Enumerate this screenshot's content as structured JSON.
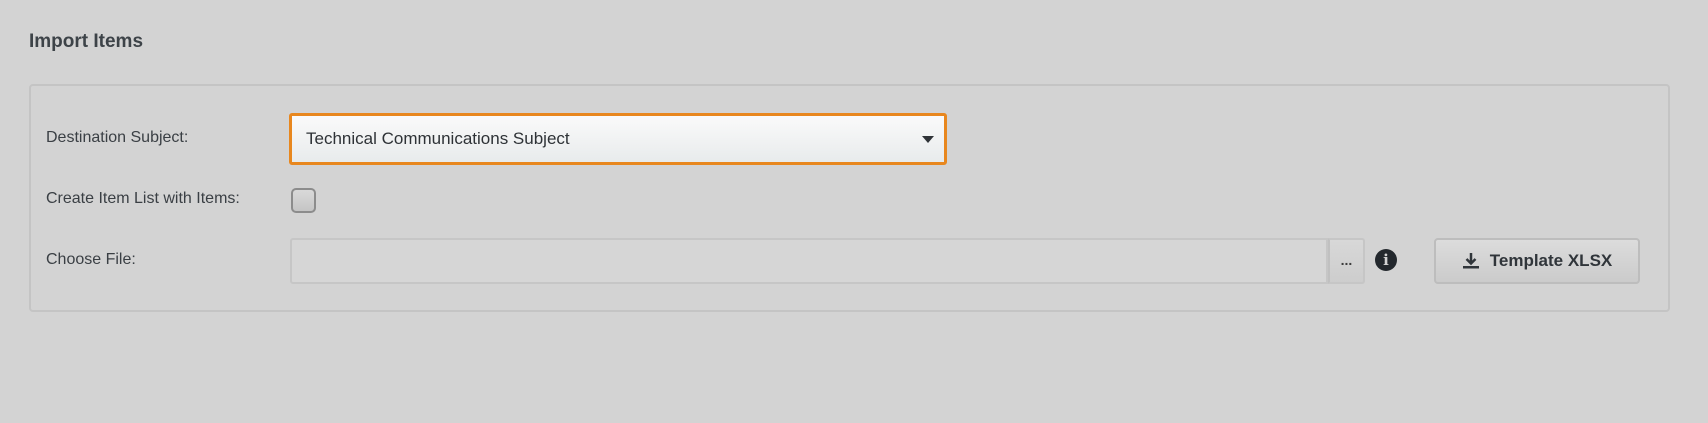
{
  "page": {
    "title": "Import Items"
  },
  "form": {
    "destination_label": "Destination Subject:",
    "destination_value": "Technical Communications Subject",
    "create_list_label": "Create Item List with Items:",
    "create_list_checked": false,
    "choose_file_label": "Choose File:",
    "file_value": "",
    "browse_label": "...",
    "info_icon": "info-icon",
    "template_button_label": "Template XLSX",
    "template_button_icon": "download-icon"
  },
  "colors": {
    "background": "#d3d3d3",
    "focus_accent": "#e8871e",
    "text": "#3a3f44"
  }
}
